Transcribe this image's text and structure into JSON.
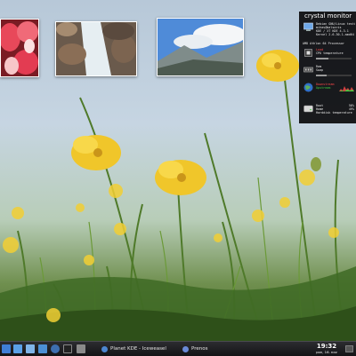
{
  "conky": {
    "title": "crystal monitor",
    "system": [
      "Debian GNU/Linux testi",
      "mihas@balsaris",
      "KDE / XT KDE 4.3.1",
      "Kernel 2.6.30-1-amd64"
    ],
    "cpu_model": "AMD Athlon 64 Processor",
    "cpu": {
      "label": "Load",
      "sub": "CPU temperature",
      "percent": 0.35
    },
    "ram": {
      "label": "Ram",
      "sub": "Swap",
      "percent": 0.3
    },
    "network": {
      "down": "Downstream",
      "up": "Upstream"
    },
    "disk": {
      "root_label": "Root",
      "root_val": "58%",
      "home_label": "Home",
      "home_val": "49%",
      "sub": "Harddisk temperature"
    }
  },
  "taskbar": {
    "tasks": [
      {
        "label": "Planet KDE - Iceweasel"
      },
      {
        "label": "Prenos"
      }
    ],
    "clock": {
      "time": "19:32",
      "date": "pon, 16. nov"
    }
  },
  "colors": {
    "taskbar": "#1c1c1f",
    "accent_red": "#ff4a4a",
    "accent_green": "#40d040"
  },
  "icons": [
    "kde-menu-icon",
    "file-manager-icon",
    "home-icon",
    "desktop-icon",
    "browser-icon",
    "terminal-icon",
    "system-icon",
    "iceweasel-icon",
    "transfer-icon",
    "tray-icon"
  ]
}
